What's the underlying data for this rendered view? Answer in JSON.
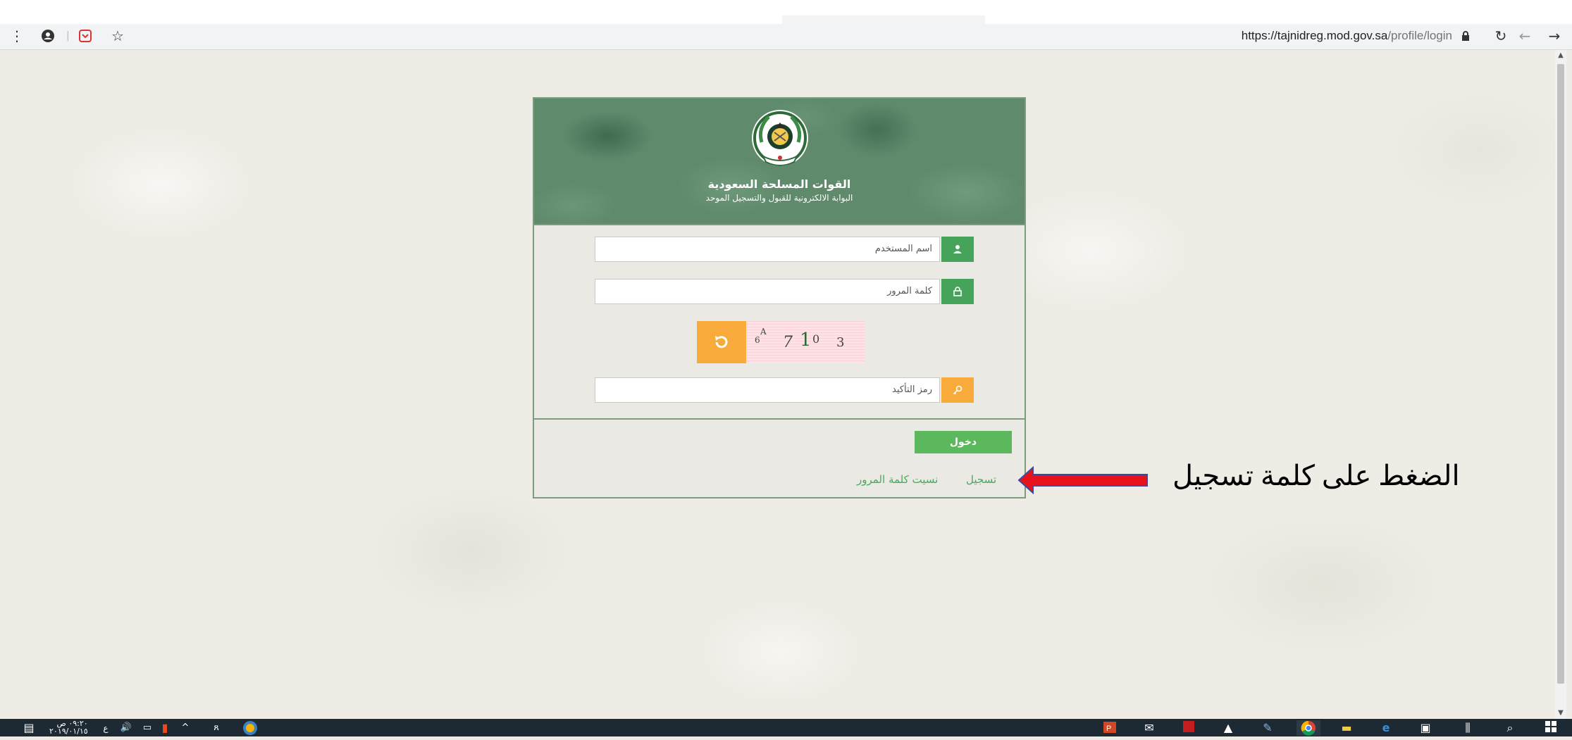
{
  "browser": {
    "url_host": "https://tajnidreg.mod.gov.sa",
    "url_path": "/profile/login",
    "icons": [
      "menu-icon",
      "profile-icon",
      "pocket-icon",
      "star-icon",
      "lock-icon",
      "reload-icon",
      "back-icon",
      "forward-icon"
    ]
  },
  "brand": {
    "title": "القوات المسلحة السعودية",
    "subtitle": "البوابة الالكترونية للقبول والتسجيل الموحد"
  },
  "form": {
    "username_placeholder": "اسم المستخدم",
    "password_placeholder": "كلمة المرور",
    "captcha_placeholder": "رمز التأكيد",
    "captcha_chars": [
      "6",
      "A",
      "7",
      "1",
      "0",
      "3"
    ],
    "login_label": "دخول",
    "register_label": "تسجيل",
    "forgot_label": "نسيت كلمة المرور"
  },
  "annotation": {
    "text": "الضغط على كلمة تسجيل"
  },
  "taskbar": {
    "time": "٠٩:٢٠ ص",
    "date": "٢٠١٩/٠١/١٥",
    "lang": "ع"
  },
  "colors": {
    "green": "#45a35a",
    "button_green": "#5cb85c",
    "orange": "#f8aa3b",
    "link_green": "#4aa85e",
    "arrow_red": "#e8121c"
  }
}
